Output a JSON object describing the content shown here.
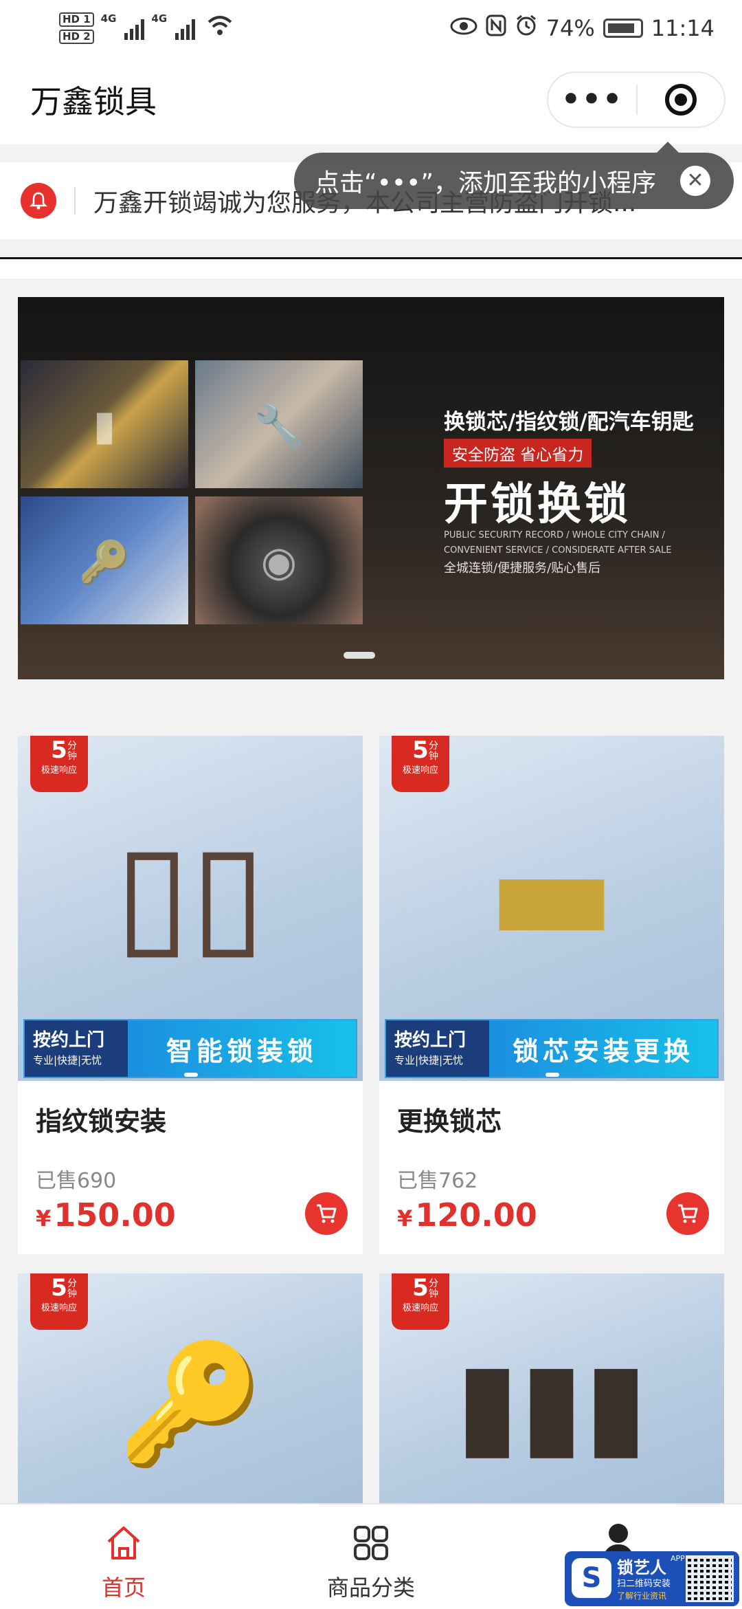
{
  "status_bar": {
    "hd1": "HD 1",
    "hd2": "HD 2",
    "net1": "4G",
    "net2": "4G",
    "battery": "74%",
    "time": "11:14"
  },
  "nav": {
    "title": "万鑫锁具",
    "more_icon": "more-dots-icon",
    "close_icon": "target-circle-icon"
  },
  "notice": {
    "icon": "bell-icon",
    "text": "万鑫开锁竭诚为您服务，本公司主营防盗门开锁..."
  },
  "tooltip": {
    "text": "点击“•••”，添加至我的小程序"
  },
  "banner": {
    "headline": "换锁芯/指纹锁/配汽车钥匙",
    "tag": "安全防盗 省心省力",
    "big_text": "开锁换锁",
    "english": "PUBLIC SECURITY RECORD / WHOLE CITY CHAIN / CONVENIENT SERVICE / CONSIDERATE AFTER SALE",
    "sub": "全城连锁/便捷服务/贴心售后"
  },
  "products": [
    {
      "badge_num": "5",
      "badge_unit": "分钟",
      "badge_text": "极速响应",
      "strip_left_title": "按约上门",
      "strip_left_sub": "专业|快捷|无忧",
      "strip_right": "智能锁装锁",
      "name": "指纹锁安装",
      "sold": "已售690",
      "currency": "¥",
      "price": "150.00"
    },
    {
      "badge_num": "5",
      "badge_unit": "分钟",
      "badge_text": "极速响应",
      "strip_left_title": "按约上门",
      "strip_left_sub": "专业|快捷|无忧",
      "strip_right": "锁芯安装更换",
      "name": "更换锁芯",
      "sold": "已售762",
      "currency": "¥",
      "price": "120.00"
    },
    {
      "badge_num": "5",
      "badge_unit": "分钟",
      "badge_text": "极速响应"
    },
    {
      "badge_num": "5",
      "badge_unit": "分钟",
      "badge_text": "极速响应"
    }
  ],
  "tabs": [
    {
      "label": "首页",
      "icon": "home-icon",
      "active": true
    },
    {
      "label": "商品分类",
      "icon": "grid-icon",
      "active": false
    },
    {
      "label": "",
      "icon": "person-icon",
      "active": false
    }
  ],
  "watermark": {
    "name": "锁艺人",
    "app": "APP",
    "line1": "扫二维码安装",
    "line2": "了解行业资讯"
  },
  "colors": {
    "accent": "#e0312c",
    "banner_tag": "#c8261f",
    "strip_blue": "#1b8fe0"
  }
}
